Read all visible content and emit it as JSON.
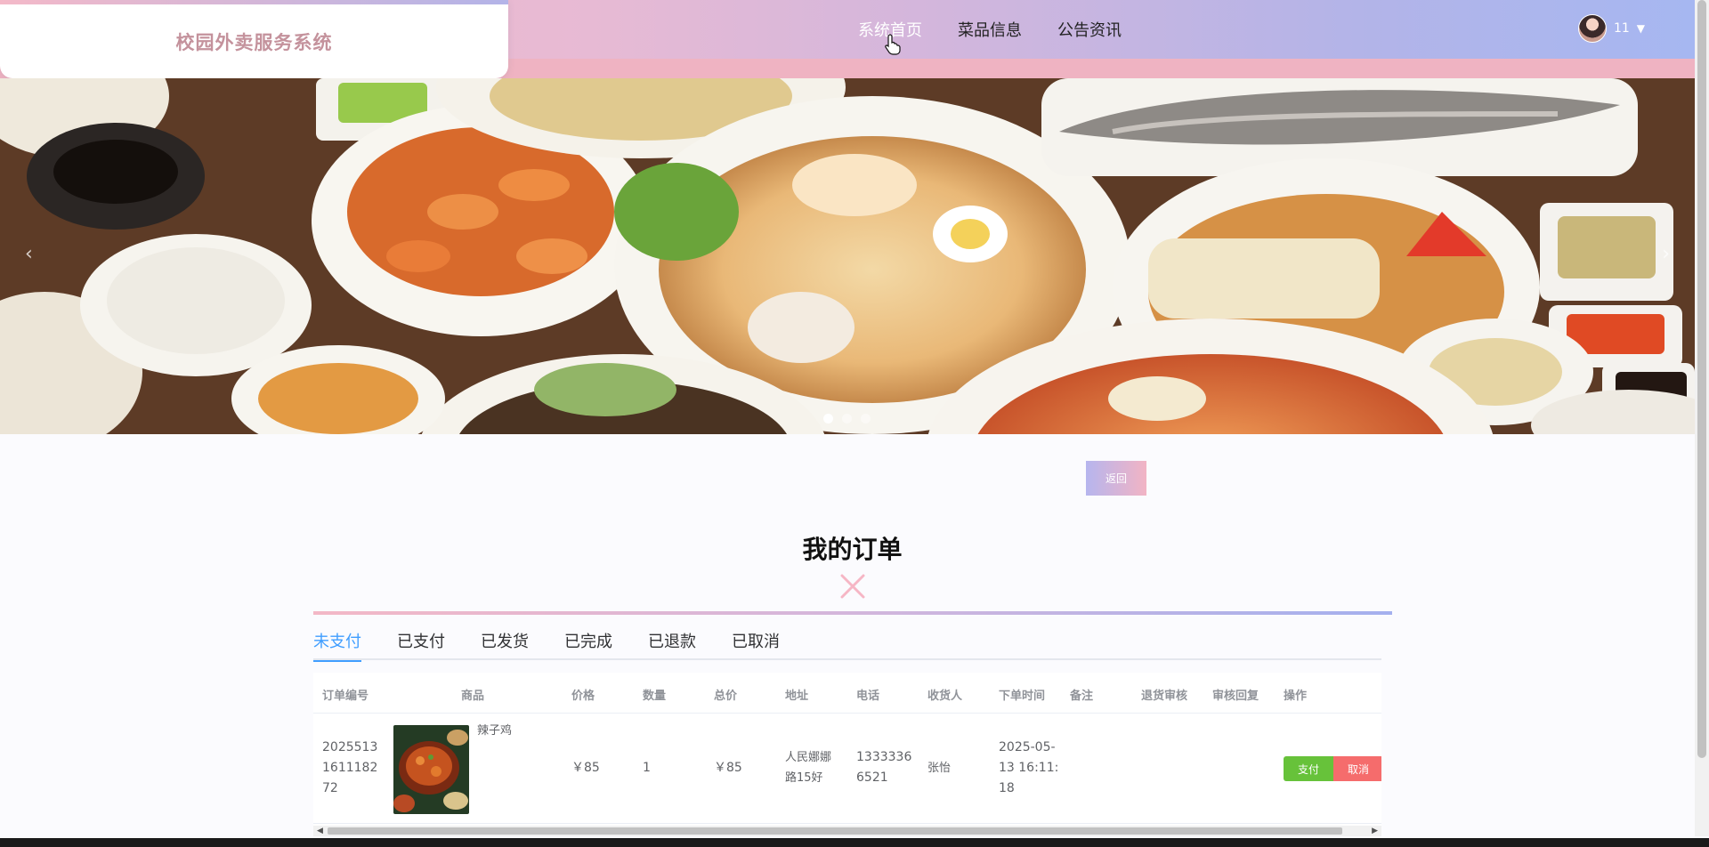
{
  "header": {
    "brand_title": "校园外卖服务系统",
    "nav": [
      {
        "label": "系统首页"
      },
      {
        "label": "菜品信息"
      },
      {
        "label": "公告资讯"
      }
    ],
    "user": {
      "name": "11"
    }
  },
  "banner": {
    "prev_icon": "‹",
    "next_icon": "›",
    "slide_count": 3,
    "active_slide": 1
  },
  "back_button_label": "返回",
  "section_title": "我的订单",
  "tabs": [
    {
      "label": "未支付"
    },
    {
      "label": "已支付"
    },
    {
      "label": "已发货"
    },
    {
      "label": "已完成"
    },
    {
      "label": "已退款"
    },
    {
      "label": "已取消"
    }
  ],
  "table": {
    "headers": [
      "订单编号",
      "商品",
      "价格",
      "数量",
      "总价",
      "地址",
      "电话",
      "收货人",
      "下单时间",
      "备注",
      "退货审核",
      "审核回复",
      "操作"
    ],
    "rows": [
      {
        "order_no": "2025513161118272",
        "order_no_lines": [
          "2025513",
          "1611182",
          "72"
        ],
        "product": "辣子鸡",
        "price": "￥85",
        "quantity": "1",
        "total": "￥85",
        "address_lines": [
          "人民娜娜",
          "路15好"
        ],
        "phone_lines": [
          "1333336",
          "6521"
        ],
        "receiver": "张怡",
        "time_lines": [
          "2025-05-",
          "13 16:11:",
          "18"
        ],
        "remark": "",
        "return_review": "",
        "review_reply": "",
        "pay_label": "支付",
        "cancel_label": "取消"
      }
    ]
  },
  "colors": {
    "header_gradient_start": "#f4b9c8",
    "header_gradient_end": "#a6b7f1",
    "brand": "#c4929c",
    "tab_active": "#409eff",
    "pay": "#67c23a",
    "cancel": "#f56c6c"
  }
}
